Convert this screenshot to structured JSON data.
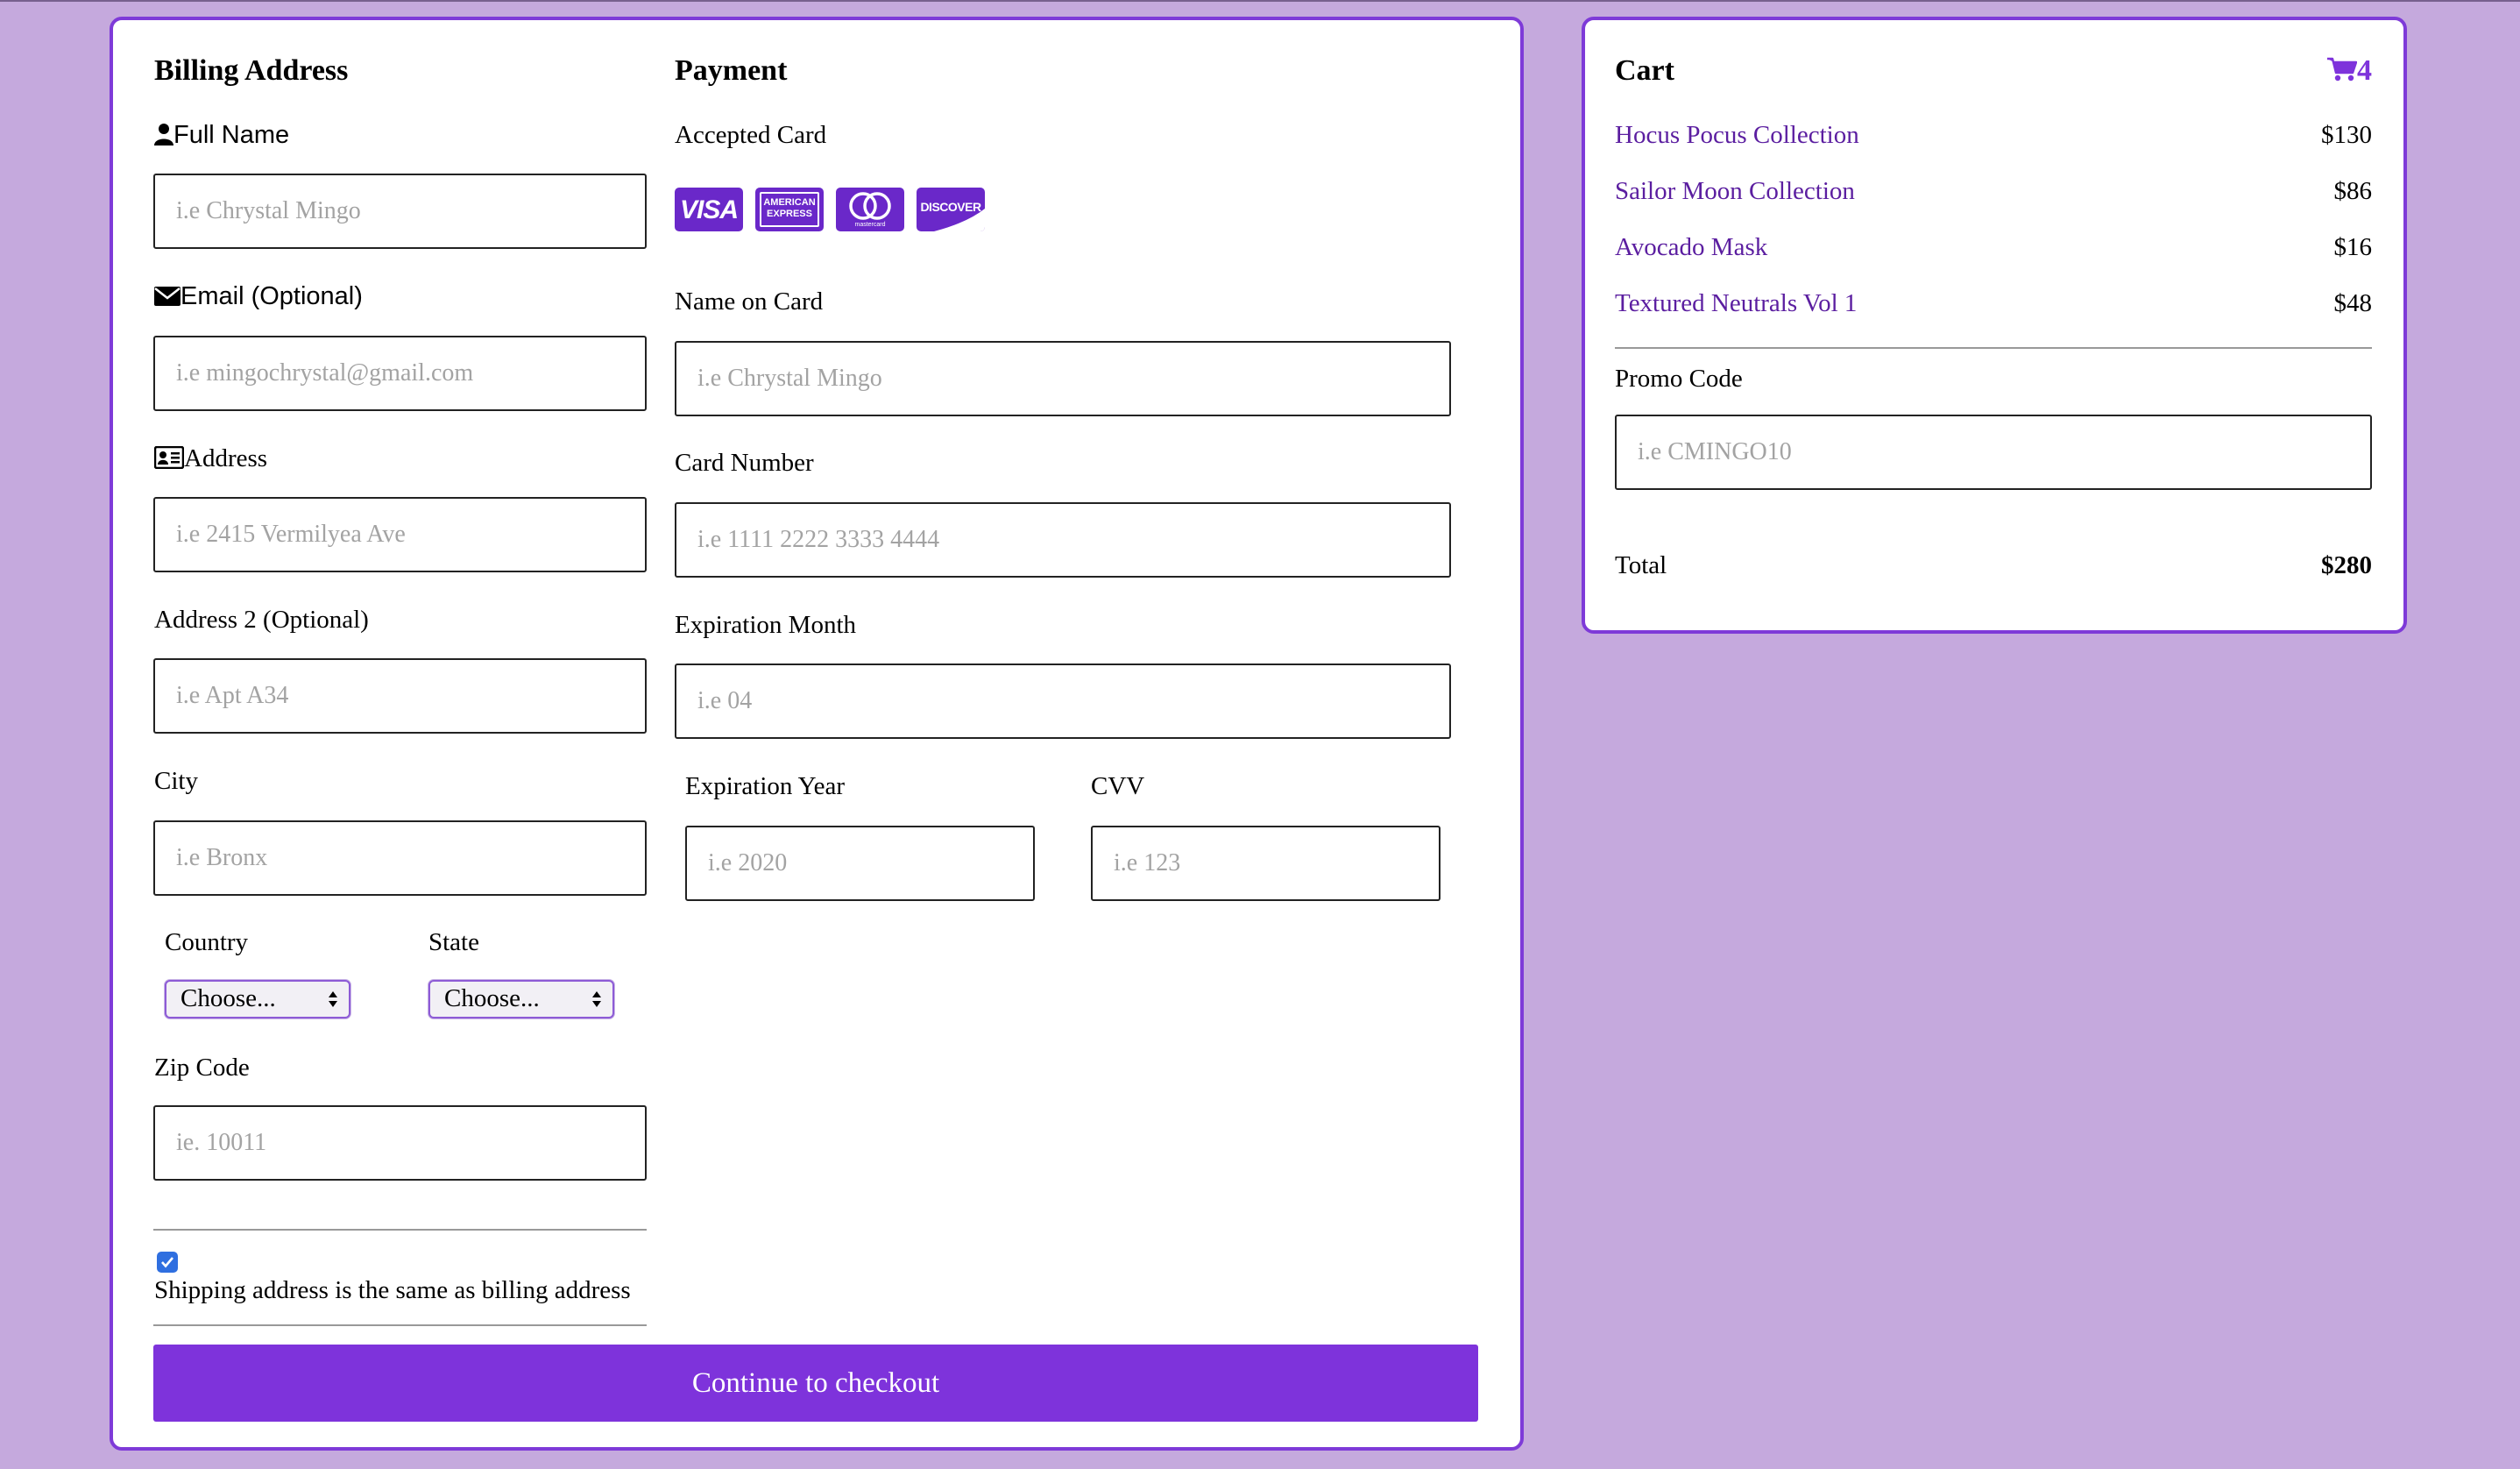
{
  "billing": {
    "title": "Billing Address",
    "full_name": {
      "label": "Full Name",
      "placeholder": "i.e Chrystal Mingo"
    },
    "email": {
      "label": "Email (Optional)",
      "placeholder": "i.e mingochrystal@gmail.com"
    },
    "address": {
      "label": "Address",
      "placeholder": "i.e 2415 Vermilyea Ave"
    },
    "address2": {
      "label": "Address 2 (Optional)",
      "placeholder": "i.e Apt A34"
    },
    "city": {
      "label": "City",
      "placeholder": "i.e Bronx"
    },
    "country": {
      "label": "Country",
      "selected": "Choose..."
    },
    "state": {
      "label": "State",
      "selected": "Choose..."
    },
    "zip": {
      "label": "Zip Code",
      "placeholder": "ie. 10011"
    },
    "same_address": {
      "label": "Shipping address is the same as billing address",
      "checked": true
    }
  },
  "payment": {
    "title": "Payment",
    "accepted_label": "Accepted Card",
    "cards": [
      "visa-icon",
      "amex-icon",
      "mastercard-icon",
      "discover-icon"
    ],
    "card_texts": {
      "visa": "VISA",
      "amex_1": "AMERICAN",
      "amex_2": "EXPRESS",
      "mastercard": "mastercard",
      "discover": "DISCOVER"
    },
    "name_on_card": {
      "label": "Name on Card",
      "placeholder": "i.e Chrystal Mingo"
    },
    "card_number": {
      "label": "Card Number",
      "placeholder": "i.e 1111 2222 3333 4444"
    },
    "exp_month": {
      "label": "Expiration Month",
      "placeholder": "i.e 04"
    },
    "exp_year": {
      "label": "Expiration Year",
      "placeholder": "i.e 2020"
    },
    "cvv": {
      "label": "CVV",
      "placeholder": "i.e 123"
    }
  },
  "checkout_button": "Continue to checkout",
  "cart": {
    "title": "Cart",
    "count": "4",
    "items": [
      {
        "name": "Hocus Pocus Collection",
        "price": "$130"
      },
      {
        "name": "Sailor Moon Collection",
        "price": "$86"
      },
      {
        "name": "Avocado Mask",
        "price": "$16"
      },
      {
        "name": "Textured Neutrals Vol 1",
        "price": "$48"
      }
    ],
    "promo": {
      "label": "Promo Code",
      "placeholder": "i.e CMINGO10"
    },
    "total_label": "Total",
    "total_value": "$280"
  },
  "colors": {
    "background": "#c5a9dd",
    "accent": "#7e33db",
    "link": "#5b1ea0",
    "card_border": "#7e3ad8"
  }
}
